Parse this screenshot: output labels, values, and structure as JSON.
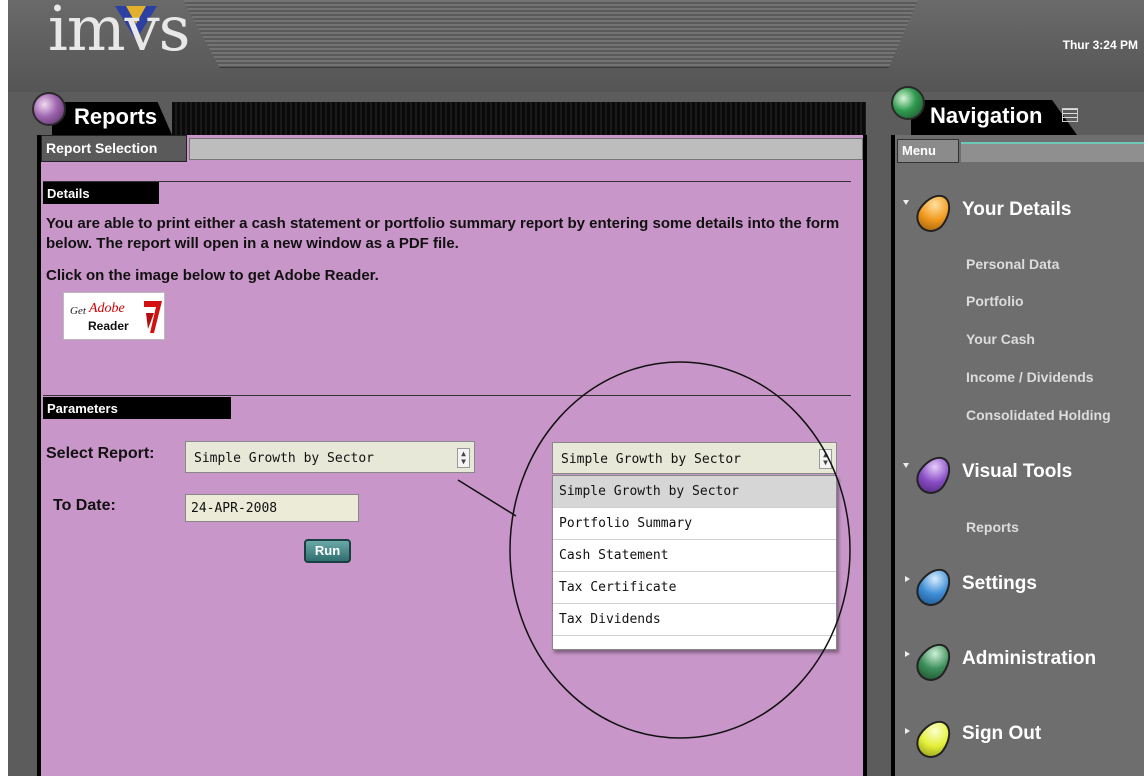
{
  "header": {
    "logo_text": "imvs",
    "clock": "Thur 3:24 PM"
  },
  "reports": {
    "title": "Reports",
    "subtab": "Report Selection",
    "details": {
      "label": "Details",
      "text": "You are able to print either a cash statement or portfolio summary report by entering some details into the form below. The report will open in a new window as a PDF file.",
      "adobe_text": "Click on the image below to get Adobe Reader.",
      "adobe_badge": {
        "get": "Get",
        "adobe": "Adobe",
        "reader": "Reader"
      }
    },
    "parameters": {
      "label": "Parameters",
      "select_report_label": "Select Report:",
      "select_report_value": "Simple Growth by Sector",
      "to_date_label": "To Date:",
      "to_date_value": "24-APR-2008",
      "run_label": "Run"
    },
    "dropdown_zoom": {
      "selected": "Simple Growth by Sector",
      "options": [
        "Simple Growth by Sector",
        "Portfolio Summary",
        "Cash Statement",
        "Tax Certificate",
        "Tax Dividends"
      ]
    }
  },
  "navigation": {
    "title": "Navigation",
    "menu_tab": "Menu",
    "groups": [
      {
        "label": "Your Details",
        "icon": "orange-gem-icon",
        "color": "#f29a1f",
        "expanded": true,
        "items": [
          "Personal Data",
          "Portfolio",
          "Your Cash",
          "Income / Dividends",
          "Consolidated Holding"
        ]
      },
      {
        "label": "Visual Tools",
        "icon": "purple-gem-icon",
        "color": "#8a4fc6",
        "expanded": true,
        "items": [
          "Reports"
        ]
      },
      {
        "label": "Settings",
        "icon": "blue-gem-icon",
        "color": "#3f8fd6",
        "expanded": false,
        "items": []
      },
      {
        "label": "Administration",
        "icon": "green-gem-icon",
        "color": "#3d8f5a",
        "expanded": false,
        "items": []
      },
      {
        "label": "Sign Out",
        "icon": "yellow-gem-icon",
        "color": "#e4f03a",
        "expanded": false,
        "items": []
      }
    ]
  },
  "colors": {
    "content_bg": "#c896c8",
    "nav_bg": "#6e6e6e",
    "frame_bg": "#5c5c5c"
  }
}
